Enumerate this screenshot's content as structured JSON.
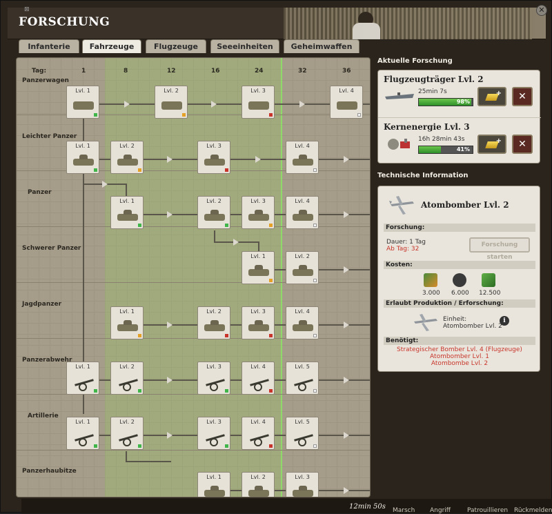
{
  "window": {
    "title": "FORSCHUNG",
    "corner_mark": "⊠",
    "close_symbol": "✕"
  },
  "tabs": [
    {
      "label": "Infanterie",
      "active": false
    },
    {
      "label": "Fahrzeuge",
      "active": true
    },
    {
      "label": "Flugzeuge",
      "active": false
    },
    {
      "label": "Seeeinheiten",
      "active": false
    },
    {
      "label": "Geheimwaffen",
      "active": false
    }
  ],
  "grid": {
    "tag_label": "Tag:",
    "days": [
      "1",
      "8",
      "12",
      "16",
      "24",
      "32",
      "36"
    ],
    "rows": [
      {
        "label": "Panzerwagen",
        "nodes": [
          {
            "label": "Lvl. 1",
            "kind": "car",
            "status": "g"
          },
          {
            "label": "Lvl. 2",
            "kind": "car",
            "status": "o"
          },
          {
            "label": "Lvl. 3",
            "kind": "car",
            "status": "r"
          },
          {
            "label": "Lvl. 4",
            "kind": "car",
            "status": "w"
          }
        ]
      },
      {
        "label": "Leichter Panzer",
        "nodes": [
          {
            "label": "Lvl. 1",
            "kind": "tank",
            "status": "g"
          },
          {
            "label": "Lvl. 2",
            "kind": "tank",
            "status": "o"
          },
          {
            "label": "Lvl. 3",
            "kind": "tank",
            "status": "r"
          },
          {
            "label": "Lvl. 4",
            "kind": "tank",
            "status": "w"
          }
        ]
      },
      {
        "label": "Panzer",
        "nodes": [
          {
            "label": "Lvl. 1",
            "kind": "tank",
            "status": "g"
          },
          {
            "label": "Lvl. 2",
            "kind": "tank",
            "status": "g"
          },
          {
            "label": "Lvl. 3",
            "kind": "tank",
            "status": "o"
          },
          {
            "label": "Lvl. 4",
            "kind": "tank",
            "status": "w"
          }
        ]
      },
      {
        "label": "Schwerer Panzer",
        "nodes": [
          {
            "label": "Lvl. 1",
            "kind": "tank",
            "status": "o"
          },
          {
            "label": "Lvl. 2",
            "kind": "tank",
            "status": "w"
          }
        ]
      },
      {
        "label": "Jagdpanzer",
        "nodes": [
          {
            "label": "Lvl. 1",
            "kind": "tank",
            "status": "o"
          },
          {
            "label": "Lvl. 2",
            "kind": "tank",
            "status": "r"
          },
          {
            "label": "Lvl. 3",
            "kind": "tank",
            "status": "r"
          },
          {
            "label": "Lvl. 4",
            "kind": "tank",
            "status": "w"
          }
        ]
      },
      {
        "label": "Panzerabwehr",
        "nodes": [
          {
            "label": "Lvl. 1",
            "kind": "gun",
            "status": "g"
          },
          {
            "label": "Lvl. 2",
            "kind": "gun",
            "status": "g"
          },
          {
            "label": "Lvl. 3",
            "kind": "gun",
            "status": "g"
          },
          {
            "label": "Lvl. 4",
            "kind": "gun",
            "status": "r"
          },
          {
            "label": "Lvl. 5",
            "kind": "gun",
            "status": "w"
          }
        ]
      },
      {
        "label": "Artillerie",
        "nodes": [
          {
            "label": "Lvl. 1",
            "kind": "gun",
            "status": "g"
          },
          {
            "label": "Lvl. 2",
            "kind": "gun",
            "status": "g"
          },
          {
            "label": "Lvl. 3",
            "kind": "gun",
            "status": "g"
          },
          {
            "label": "Lvl. 4",
            "kind": "gun",
            "status": "r"
          },
          {
            "label": "Lvl. 5",
            "kind": "gun",
            "status": "w"
          }
        ]
      },
      {
        "label": "Panzerhaubitze",
        "nodes": [
          {
            "label": "Lvl. 1",
            "kind": "tank",
            "status": "g"
          },
          {
            "label": "Lvl. 2",
            "kind": "tank",
            "status": "g"
          },
          {
            "label": "Lvl. 3",
            "kind": "tank",
            "status": "w"
          }
        ]
      }
    ]
  },
  "current_research": {
    "title": "Aktuelle Forschung",
    "items": [
      {
        "name": "Flugzeugträger Lvl. 2",
        "time": "25min 7s",
        "progress": 0.98,
        "percent_text": "98%"
      },
      {
        "name": "Kernenergie Lvl. 3",
        "time": "16h 28min 43s",
        "progress": 0.41,
        "percent_text": "41%"
      }
    ]
  },
  "tech_info": {
    "title": "Technische Information",
    "name": "Atombomber Lvl. 2",
    "research_header": "Forschung:",
    "duration": "Dauer: 1 Tag",
    "from_day": "Ab Tag: 32",
    "start_button": "Forschung starten",
    "costs_header": "Kosten:",
    "costs": [
      "3.000",
      "6.000",
      "12.500"
    ],
    "allows_header": "Erlaubt Produktion / Erforschung:",
    "unit_label": "Einheit:",
    "unit_name": "Atombomber Lvl. 2",
    "required_header": "Benötigt:",
    "required": [
      "Strategischer Bomber Lvl. 4 (Flugzeuge)",
      "Atombomber Lvl. 1",
      "Atombombe Lvl. 2"
    ]
  },
  "bottom": {
    "time": "12min 50s",
    "labels": [
      "Marsch",
      "Angriff",
      "Patrouillieren",
      "Rückmelden"
    ]
  }
}
